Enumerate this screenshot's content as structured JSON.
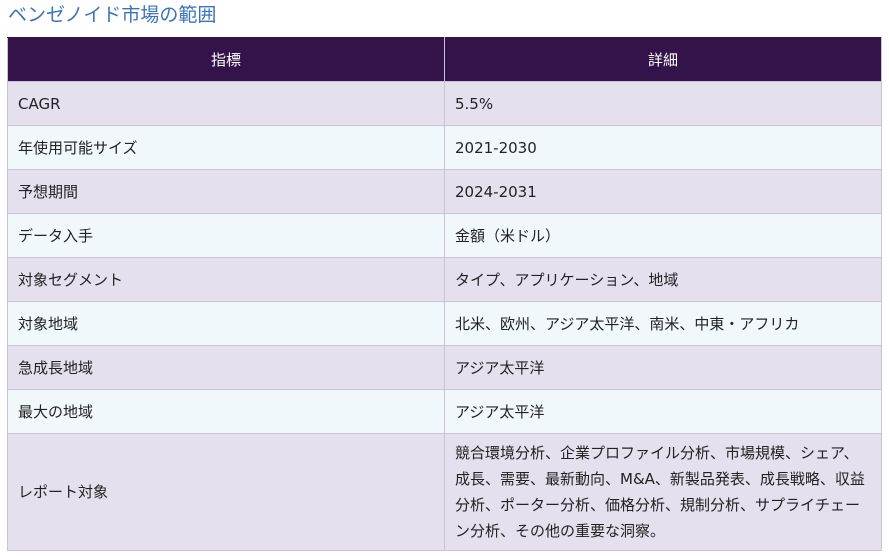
{
  "heading": "ベンゼノイド市場の範囲",
  "table": {
    "headers": [
      "指標",
      "詳細"
    ],
    "rows": [
      {
        "metric": "CAGR",
        "detail": "5.5%"
      },
      {
        "metric": "年使用可能サイズ",
        "detail": "2021-2030"
      },
      {
        "metric": "予想期間",
        "detail": "2024-2031"
      },
      {
        "metric": "データ入手",
        "detail": "金額（米ドル）"
      },
      {
        "metric": "対象セグメント",
        "detail": "タイプ、アプリケーション、地域"
      },
      {
        "metric": "対象地域",
        "detail": "北米、欧州、アジア太平洋、南米、中東・アフリカ"
      },
      {
        "metric": "急成長地域",
        "detail": "アジア太平洋"
      },
      {
        "metric": "最大の地域",
        "detail": "アジア太平洋"
      },
      {
        "metric": "レポート対象",
        "detail": "競合環境分析、企業プロファイル分析、市場規模、シェア、成長、需要、最新動向、M&A、新製品発表、成長戦略、収益分析、ポーター分析、価格分析、規制分析、サプライチェーン分析、その他の重要な洞察。"
      }
    ]
  },
  "colors": {
    "heading_text": "#3b74b8",
    "header_bg": "#34124a",
    "row_odd_bg": "#e4e0ee",
    "row_even_bg": "#f1f8fb",
    "border": "#c9c3d3"
  }
}
